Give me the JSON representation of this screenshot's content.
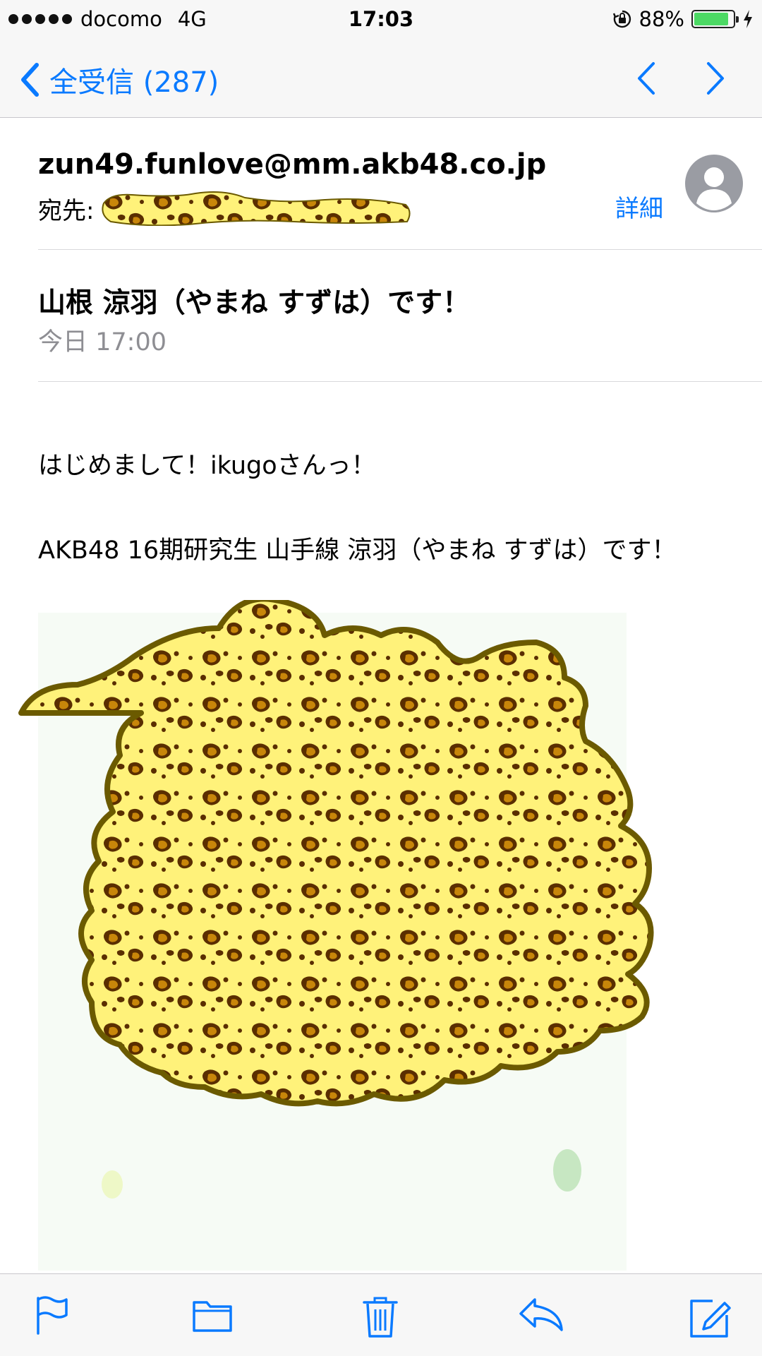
{
  "status_bar": {
    "carrier": "docomo",
    "network": "4G",
    "time": "17:03",
    "battery": "88%",
    "battery_level": 0.88,
    "icons": [
      "signal-dots-icon",
      "orientation-lock-icon",
      "battery-icon",
      "charging-bolt-icon"
    ]
  },
  "nav": {
    "back_label": "全受信 (287)",
    "icons": [
      "chevron-left-icon",
      "chevron-up-icon",
      "chevron-down-icon"
    ]
  },
  "message": {
    "from": "zun49.funlove@mm.akb48.co.jp",
    "to_label": "宛先:",
    "details_label": "詳細",
    "subject": "山根 涼羽（やまね すずは）です！",
    "date": "今日 17:00",
    "body": {
      "greeting": "はじめまして！ikugoさんっ！",
      "intro": "AKB48 16期研究生 山手線 涼羽（やまね すずは）です！"
    }
  },
  "toolbar": {
    "icons": [
      "flag-icon",
      "folder-icon",
      "trash-icon",
      "reply-icon",
      "compose-icon"
    ]
  },
  "colors": {
    "accent": "#0a7aff",
    "leopard_base": "#fff27a",
    "leopard_spot": "#c8860a",
    "leopard_outline": "#6b5a00"
  }
}
